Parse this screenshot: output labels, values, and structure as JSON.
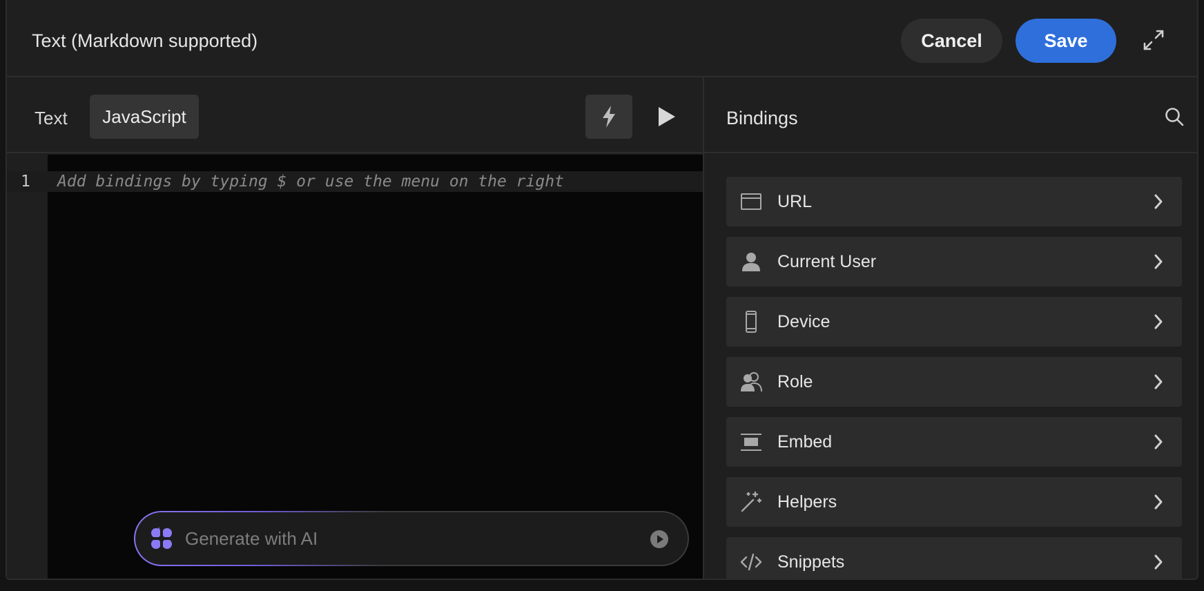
{
  "header": {
    "title": "Text (Markdown supported)",
    "cancel_label": "Cancel",
    "save_label": "Save"
  },
  "editor": {
    "mode_text_label": "Text",
    "mode_js_label": "JavaScript",
    "line_number": "1",
    "placeholder": "Add bindings by typing $ or use the menu on the right"
  },
  "ai": {
    "placeholder": "Generate with AI"
  },
  "bindings": {
    "title": "Bindings",
    "items": [
      {
        "label": "URL",
        "icon": "browser-window-icon"
      },
      {
        "label": "Current User",
        "icon": "user-icon"
      },
      {
        "label": "Device",
        "icon": "mobile-device-icon"
      },
      {
        "label": "Role",
        "icon": "users-role-icon"
      },
      {
        "label": "Embed",
        "icon": "embed-icon"
      },
      {
        "label": "Helpers",
        "icon": "magic-wand-icon"
      },
      {
        "label": "Snippets",
        "icon": "code-icon"
      }
    ]
  },
  "colors": {
    "accent": "#2f6fdb",
    "ai_gradient": "#8a74f2"
  }
}
